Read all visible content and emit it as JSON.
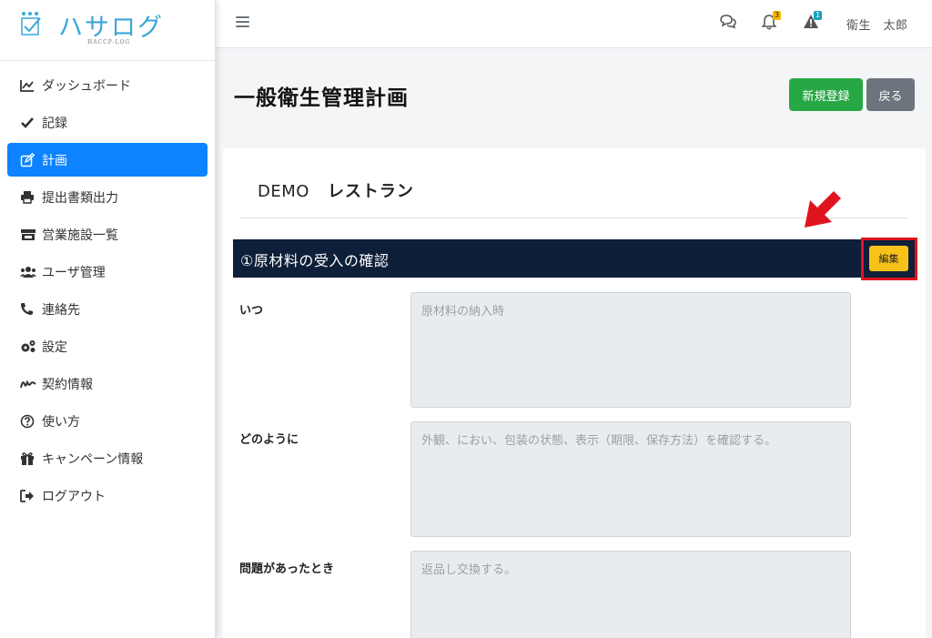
{
  "brand": {
    "name": "ハサログ",
    "subtitle": "HACCP-LOG"
  },
  "sidebar": {
    "items": [
      {
        "label": "ダッシュボード",
        "icon": "chart-line-icon",
        "active": false
      },
      {
        "label": "記録",
        "icon": "check-icon",
        "active": false
      },
      {
        "label": "計画",
        "icon": "edit-icon",
        "active": true
      },
      {
        "label": "提出書類出力",
        "icon": "printer-icon",
        "active": false
      },
      {
        "label": "営業施設一覧",
        "icon": "store-icon",
        "active": false
      },
      {
        "label": "ユーザ管理",
        "icon": "users-icon",
        "active": false
      },
      {
        "label": "連絡先",
        "icon": "phone-icon",
        "active": false
      },
      {
        "label": "設定",
        "icon": "gears-icon",
        "active": false
      },
      {
        "label": "契約情報",
        "icon": "signature-icon",
        "active": false
      },
      {
        "label": "使い方",
        "icon": "question-circle-icon",
        "active": false
      },
      {
        "label": "キャンペーン情報",
        "icon": "gift-icon",
        "active": false
      },
      {
        "label": "ログアウト",
        "icon": "sign-out-icon",
        "active": false
      }
    ]
  },
  "topbar": {
    "notifications_count": "3",
    "alerts_count": "1",
    "user_name": "衛生　太郎"
  },
  "page": {
    "title": "一般衛生管理計画",
    "new_button": "新規登録",
    "back_button": "戻る"
  },
  "store": {
    "code": "DEMO",
    "name": "レストラン"
  },
  "section": {
    "title": "①原材料の受入の確認",
    "edit_button": "編集",
    "fields": [
      {
        "label": "いつ",
        "value": "原材料の納入時"
      },
      {
        "label": "どのように",
        "value": "外観、におい、包装の状態、表示（期限、保存方法）を確認する。"
      },
      {
        "label": "問題があったとき",
        "value": "返品し交換する。"
      }
    ]
  },
  "colors": {
    "active_nav": "#0d83ff",
    "section_bar": "#0e1f3a",
    "new_button": "#28a745",
    "back_button": "#6c757d",
    "edit_button": "#f8c21a",
    "highlight": "#e0141e"
  }
}
